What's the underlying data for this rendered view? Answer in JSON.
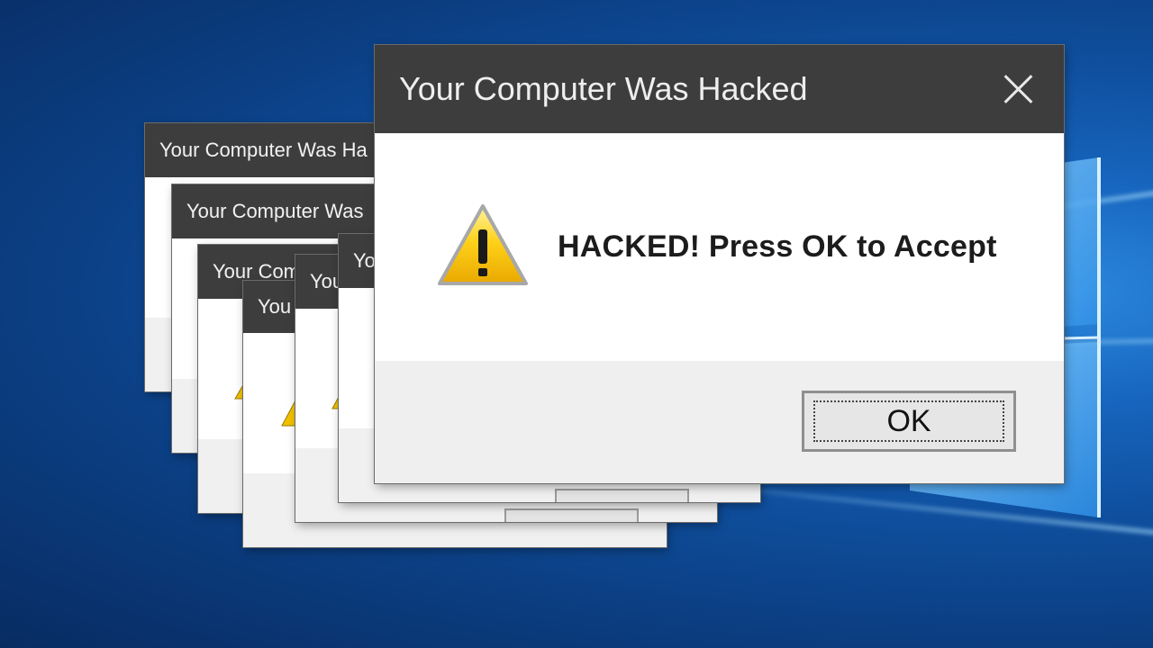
{
  "dialogs": {
    "title": "Your Computer Was Hacked",
    "background_titles": [
      "Your Computer Was Ha",
      "Your Computer Was",
      "Your Com",
      "You",
      "You",
      "Yo"
    ]
  },
  "main_dialog": {
    "title": "Your Computer Was Hacked",
    "message": "HACKED! Press OK to Accept",
    "ok_label": "OK",
    "icon": "warning-icon",
    "close_icon": "close-icon"
  },
  "colors": {
    "titlebar": "#3d3d3d",
    "dialog_body": "#ffffff",
    "dialog_footer": "#f0f0f0",
    "desktop": "#0f4f9e"
  }
}
